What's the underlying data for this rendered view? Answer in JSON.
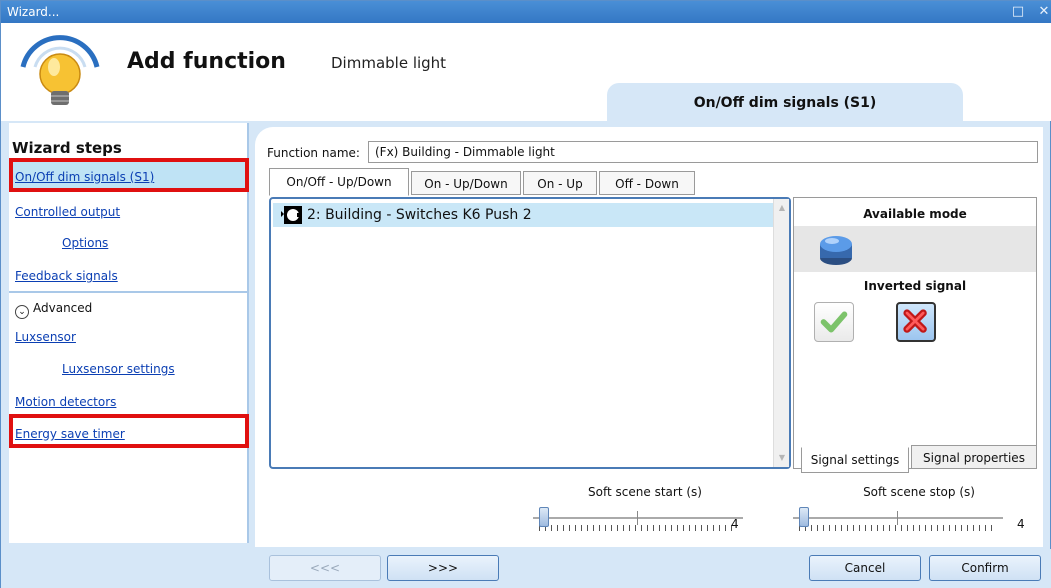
{
  "window": {
    "title": "Wizard...",
    "controls": [
      "restore-icon",
      "close-icon"
    ]
  },
  "header": {
    "title": "Add function",
    "subtitle": "Dimmable light",
    "tab": "On/Off dim signals (S1)"
  },
  "wizard": {
    "title": "Wizard steps",
    "steps": [
      {
        "label": "On/Off dim signals (S1)",
        "selected": true
      },
      {
        "label": "Controlled output"
      },
      {
        "label": "Options"
      },
      {
        "label": "Feedback signals"
      }
    ],
    "advanced_label": "Advanced",
    "advanced_steps": [
      {
        "label": "Luxsensor"
      },
      {
        "label": "Luxsensor settings"
      },
      {
        "label": "Motion detectors"
      },
      {
        "label": "Energy save timer"
      }
    ]
  },
  "form": {
    "function_name_label": "Function name:",
    "function_name_value": "(Fx) Building - Dimmable light",
    "tabs": [
      "On/Off - Up/Down",
      "On - Up/Down",
      "On - Up",
      "Off - Down"
    ],
    "active_tab": 0,
    "list_items": [
      {
        "label": "2: Building - Switches K6 Push 2"
      }
    ]
  },
  "right_panel": {
    "available_mode_label": "Available mode",
    "inverted_signal_label": "Inverted signal",
    "tabs": [
      "Signal settings",
      "Signal properties"
    ],
    "active_tab": 0
  },
  "sliders": [
    {
      "label": "Soft scene start (s)",
      "value": "4",
      "fraction": 0.0
    },
    {
      "label": "Soft scene stop (s)",
      "value": "4",
      "fraction": 0.0
    }
  ],
  "footer": {
    "back_label": "<<<",
    "next_label": ">>>",
    "cancel_label": "Cancel",
    "confirm_label": "Confirm"
  },
  "colors": {
    "selected_row": "#c9e7f7",
    "highlight": "#e01010",
    "link": "#0b3fb3",
    "titlebar": "#3a7fcc"
  }
}
